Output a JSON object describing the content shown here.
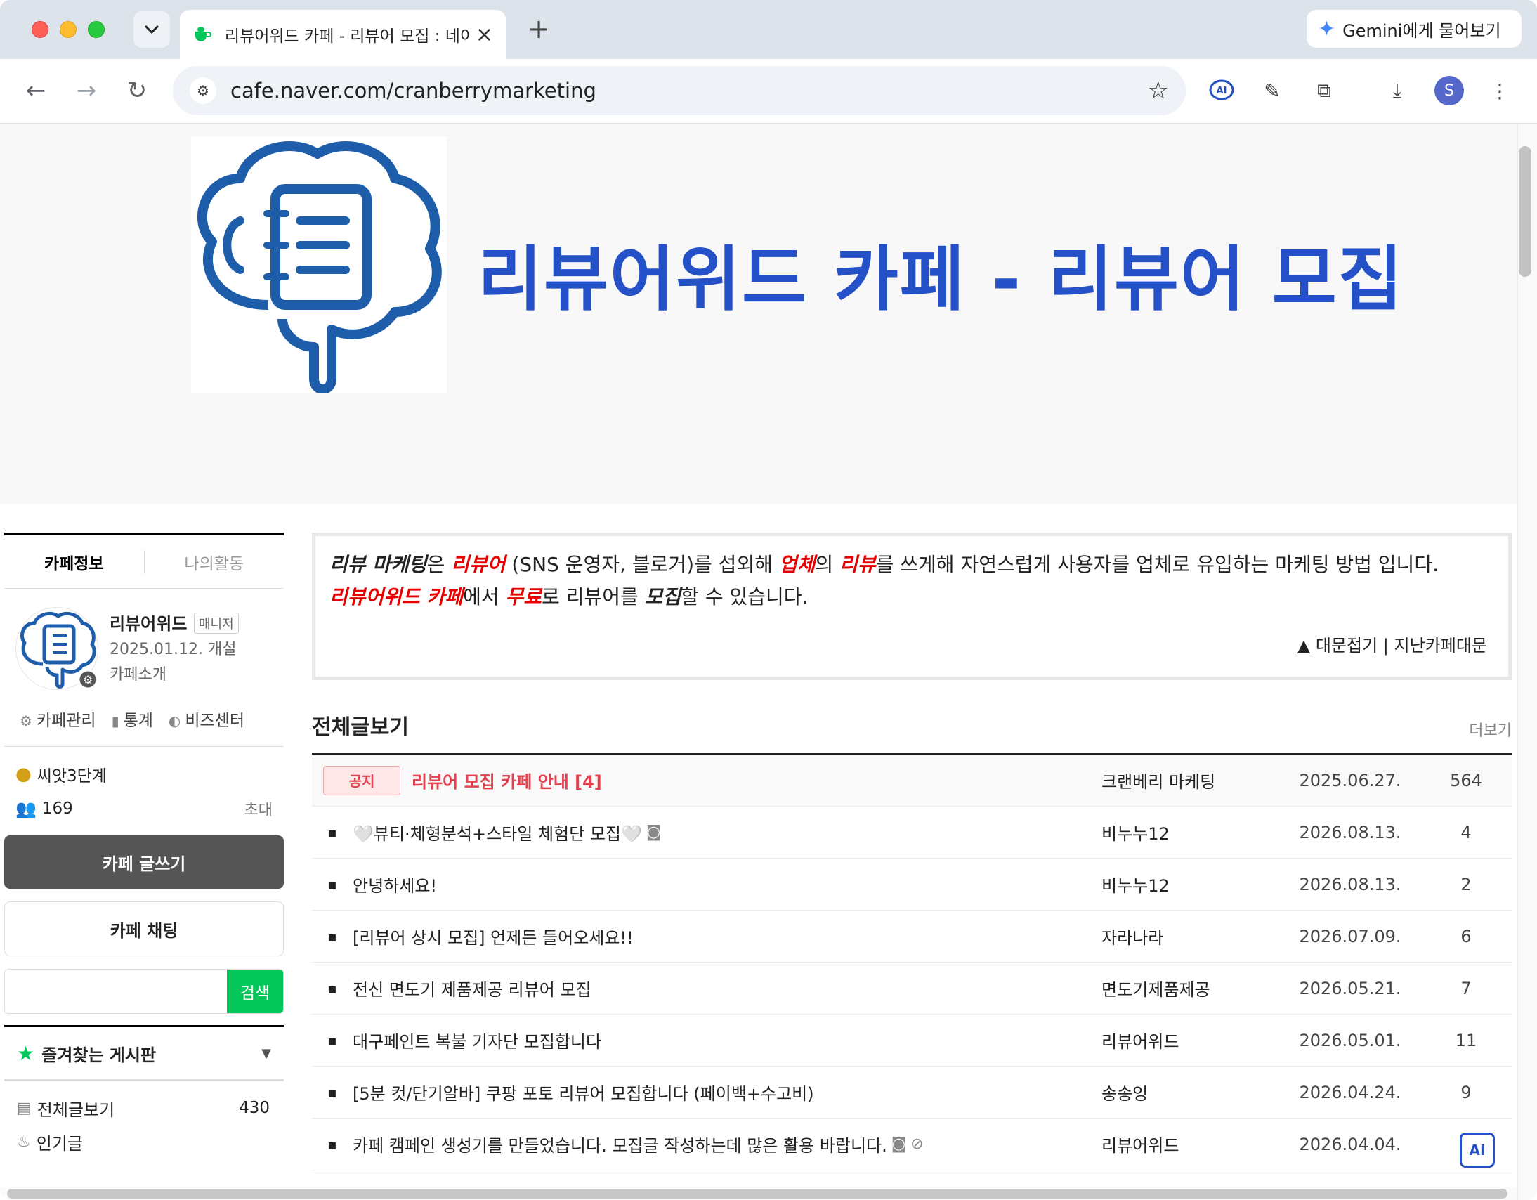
{
  "browser": {
    "tab_title": "리뷰어위드 카페 - 리뷰어 모집 : 네이버 카페",
    "gemini_label": "Gemini에게 물어보기",
    "url": "cafe.naver.com/cranberrymarketing",
    "profile_initial": "S",
    "colors": {
      "tab_strip": "#dde3ea",
      "omnibox": "#eff2f6",
      "avatar": "#5567c9"
    }
  },
  "banner": {
    "title": "리뷰어위드 카페 - 리뷰어 모집",
    "title_color": "#2450c8"
  },
  "sidebar": {
    "tabs": [
      "카페정보",
      "나의활동"
    ],
    "cafe": {
      "name": "리뷰어위드",
      "role_badge": "매니저",
      "opened": "2025.01.12. 개설",
      "intro_link": "카페소개"
    },
    "admin_links": [
      "카페관리",
      "통계",
      "비즈센터"
    ],
    "level": "씨앗3단계",
    "members": "169",
    "invite": "초대",
    "write_button": "카페 글쓰기",
    "chat_button": "카페 채팅",
    "search_button": "검색",
    "search_value": "",
    "favorites_title": "즐겨찾는 게시판",
    "boards": [
      {
        "name": "전체글보기",
        "count": "430"
      },
      {
        "name": "인기글",
        "count": ""
      }
    ]
  },
  "main": {
    "notice": {
      "line1": {
        "p1": "리뷰 마케팅",
        "p2": "은 ",
        "p3": "리뷰어",
        "p4": " (SNS 운영자, 블로거)를 섭외해 ",
        "p5": "업체",
        "p6": "의 ",
        "p7": "리뷰",
        "p8": "를 쓰게해 자연스럽게 사용자를 업체로 유입하는 마케팅 방법 입니다."
      },
      "line2": {
        "p1": "리뷰어위드 카페",
        "p2": "에서 ",
        "p3": "무료",
        "p4": "로 리뷰어를 ",
        "p5": "모집",
        "p6": "할 수 있습니다."
      },
      "fold_link": "▲ 대문접기 | 지난카페대문"
    },
    "list_title": "전체글보기",
    "more": "더보기",
    "notice_badge": "공지",
    "articles": [
      {
        "title": "리뷰어 모집 카페 안내 [4]",
        "author": "크랜베리 마케팅",
        "date": "2025.06.27.",
        "views": "564",
        "notice": true
      },
      {
        "title": "🤍뷰티·체형분석+스타일 체험단 모집🤍",
        "author": "비누누12",
        "date": "2026.08.13.",
        "views": "4",
        "icon": "image-icon"
      },
      {
        "title": "안녕하세요!",
        "author": "비누누12",
        "date": "2026.08.13.",
        "views": "2"
      },
      {
        "title": "[리뷰어 상시 모집] 언제든 들어오세요!!",
        "author": "자라나라",
        "date": "2026.07.09.",
        "views": "6"
      },
      {
        "title": "전신 면도기 제품제공 리뷰어 모집",
        "author": "면도기제품제공",
        "date": "2026.05.21.",
        "views": "7"
      },
      {
        "title": "대구페인트 복불 기자단 모집합니다",
        "author": "리뷰어위드",
        "date": "2026.05.01.",
        "views": "11"
      },
      {
        "title": "[5분 컷/단기알바] 쿠팡 포토 리뷰어 모집합니다 (페이백+수고비)",
        "author": "송송잉",
        "date": "2026.04.24.",
        "views": "9"
      },
      {
        "title": "카페 캠페인 생성기를 만들었습니다. 모집글 작성하는데 많은 활용 바랍니다.",
        "author": "리뷰어위드",
        "date": "2026.04.04.",
        "views": "",
        "icon": "image-link-icons"
      }
    ],
    "ai_badge": "AI"
  }
}
